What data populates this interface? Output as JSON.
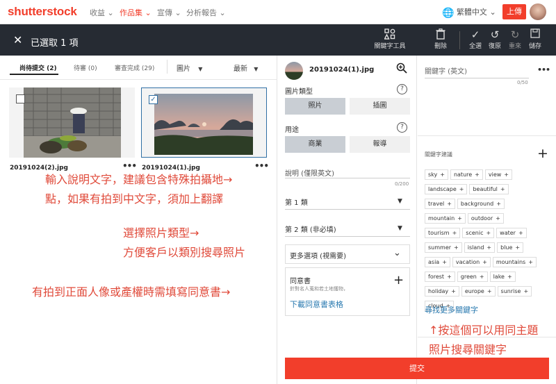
{
  "header": {
    "logo": "shutterstock",
    "nav": [
      "收益",
      "作品集",
      "宣傳",
      "分析報告"
    ],
    "language": "繁體中文",
    "upload": "上傳"
  },
  "selection_bar": {
    "selected_text": "已選取 1 項",
    "tools": [
      "關鍵字工具",
      "刪除",
      "全選",
      "復原",
      "重來",
      "儲存"
    ]
  },
  "tabs": [
    {
      "label": "尚待提交 (2)",
      "active": true
    },
    {
      "label": "待審 (0)",
      "active": false
    },
    {
      "label": "審查完成 (29)",
      "active": false
    }
  ],
  "filters": {
    "type": "圖片",
    "sort": "最新"
  },
  "thumbnails": [
    {
      "filename": "20191024(2).jpg",
      "checked": false
    },
    {
      "filename": "20191024(1).jpg",
      "checked": true
    }
  ],
  "annotations": [
    "輸入說明文字，建議包含特殊拍攝地→",
    "點，如果有拍到中文字，須加上翻譯",
    "選擇照片類型→",
    "方便客戶以類別搜尋照片",
    "有拍到正面人像或產權時需填寫同意書→",
    "↑按這個可以用同主題",
    "照片搜尋關鍵字"
  ],
  "details": {
    "filename": "20191024(1).jpg",
    "image_type_label": "圖片類型",
    "image_types": [
      "照片",
      "插圖"
    ],
    "usage_label": "用途",
    "usages": [
      "商業",
      "報導"
    ],
    "description_placeholder": "說明 (僅限英文)",
    "description_counter": "0/200",
    "category1": "第 1 類",
    "category2": "第 2 類 (非必填)",
    "more_options": "更多選項 (視需要)",
    "release_title": "同意書",
    "release_sub": "針對名人蒐和若土地獲物，",
    "release_link": "下載同意書表格",
    "submit": "提交"
  },
  "keywords": {
    "placeholder": "關鍵字 (英文)",
    "counter": "0/50",
    "suggestions_title": "關鍵字建議",
    "chips": [
      "sky",
      "nature",
      "view",
      "landscape",
      "beautiful",
      "travel",
      "background",
      "mountain",
      "outdoor",
      "tourism",
      "scenic",
      "water",
      "summer",
      "island",
      "blue",
      "asia",
      "vacation",
      "mountains",
      "forest",
      "green",
      "lake",
      "holiday",
      "europe",
      "sunrise",
      "cloud"
    ],
    "find_more": "尋找更多關鍵字"
  }
}
